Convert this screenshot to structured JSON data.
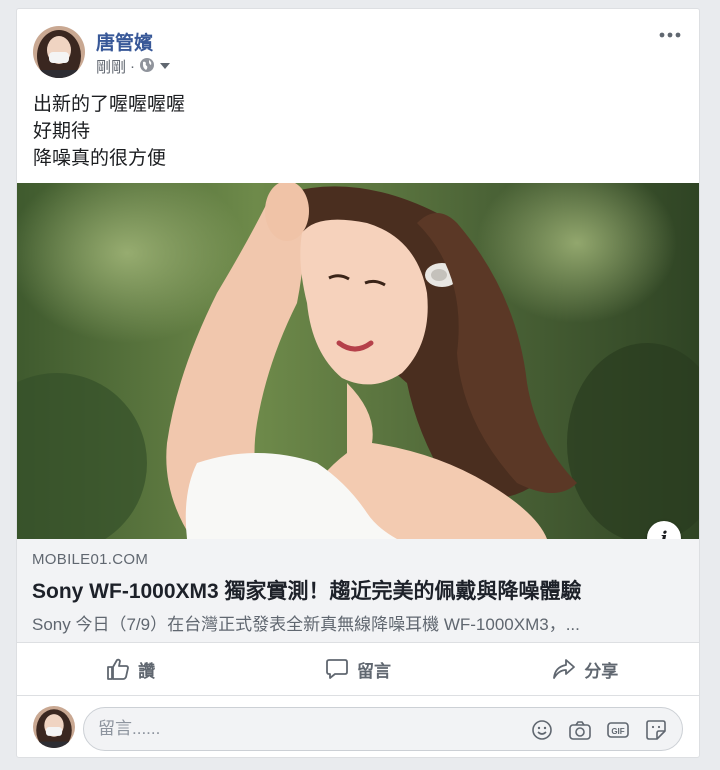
{
  "post": {
    "author": "唐管嬪",
    "time": "剛剛",
    "separator": "·",
    "privacy_icon": "globe-icon",
    "text_lines": [
      "出新的了喔喔喔喔",
      "好期待",
      "降噪真的很方便"
    ]
  },
  "link_preview": {
    "domain": "MOBILE01.COM",
    "title": "Sony WF-1000XM3 獨家實測！趨近完美的佩戴與降噪體驗",
    "description": "Sony 今日（7/9）在台灣正式發表全新真無線降噪耳機 WF-1000XM3，...",
    "info_glyph": "i"
  },
  "actions": {
    "like": "讚",
    "comment": "留言",
    "share": "分享"
  },
  "comment_input": {
    "placeholder": "留言......"
  },
  "colors": {
    "author": "#385898",
    "background": "#e9ebee",
    "secondary_text": "#606770"
  }
}
